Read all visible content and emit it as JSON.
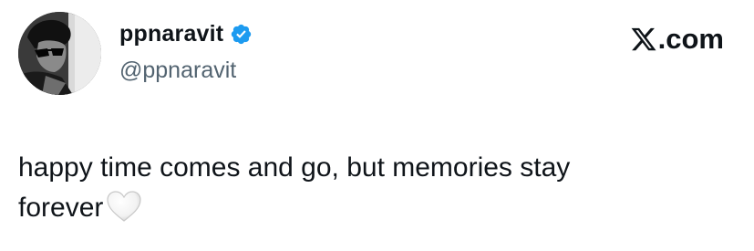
{
  "profile": {
    "display_name": "ppnaravit",
    "handle": "@ppnaravit",
    "verified": true,
    "verified_color": "#1d9bf0"
  },
  "brand": {
    "label": ".com",
    "icon": "x-logo-icon"
  },
  "tweet": {
    "line1": "happy time comes and go, but memories stay",
    "line2": "forever",
    "emoji": "white-heart-icon"
  },
  "colors": {
    "text": "#0f1419",
    "secondary": "#536471"
  }
}
